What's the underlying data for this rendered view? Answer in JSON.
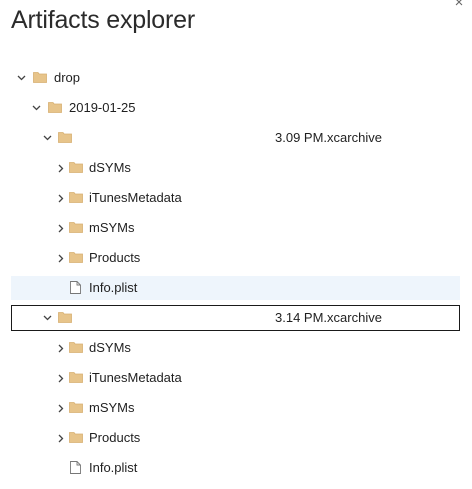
{
  "header": {
    "title": "Artifacts explorer",
    "close_glyph": "×"
  },
  "tree": {
    "root": {
      "label": "drop",
      "expanded": true
    },
    "date_folder": {
      "label": "2019-01-25",
      "expanded": true
    },
    "archive_1": {
      "label": "3.09 PM.xcarchive",
      "expanded": true,
      "children": [
        "dSYMs",
        "iTunesMetadata",
        "mSYMs",
        "Products"
      ],
      "file": "Info.plist"
    },
    "archive_2": {
      "label": "3.14 PM.xcarchive",
      "expanded": true,
      "children": [
        "dSYMs",
        "iTunesMetadata",
        "mSYMs",
        "Products"
      ],
      "file": "Info.plist"
    }
  },
  "icons": {
    "folder": "folder-icon",
    "file": "file-icon",
    "chevron_right": "chevron-right-icon",
    "chevron_down": "chevron-down-icon"
  },
  "colors": {
    "folder_fill": "#e7c48a",
    "folder_tab": "#d8b072",
    "hover_row": "#eef5fc",
    "selected_border": "#1a1a1a"
  }
}
